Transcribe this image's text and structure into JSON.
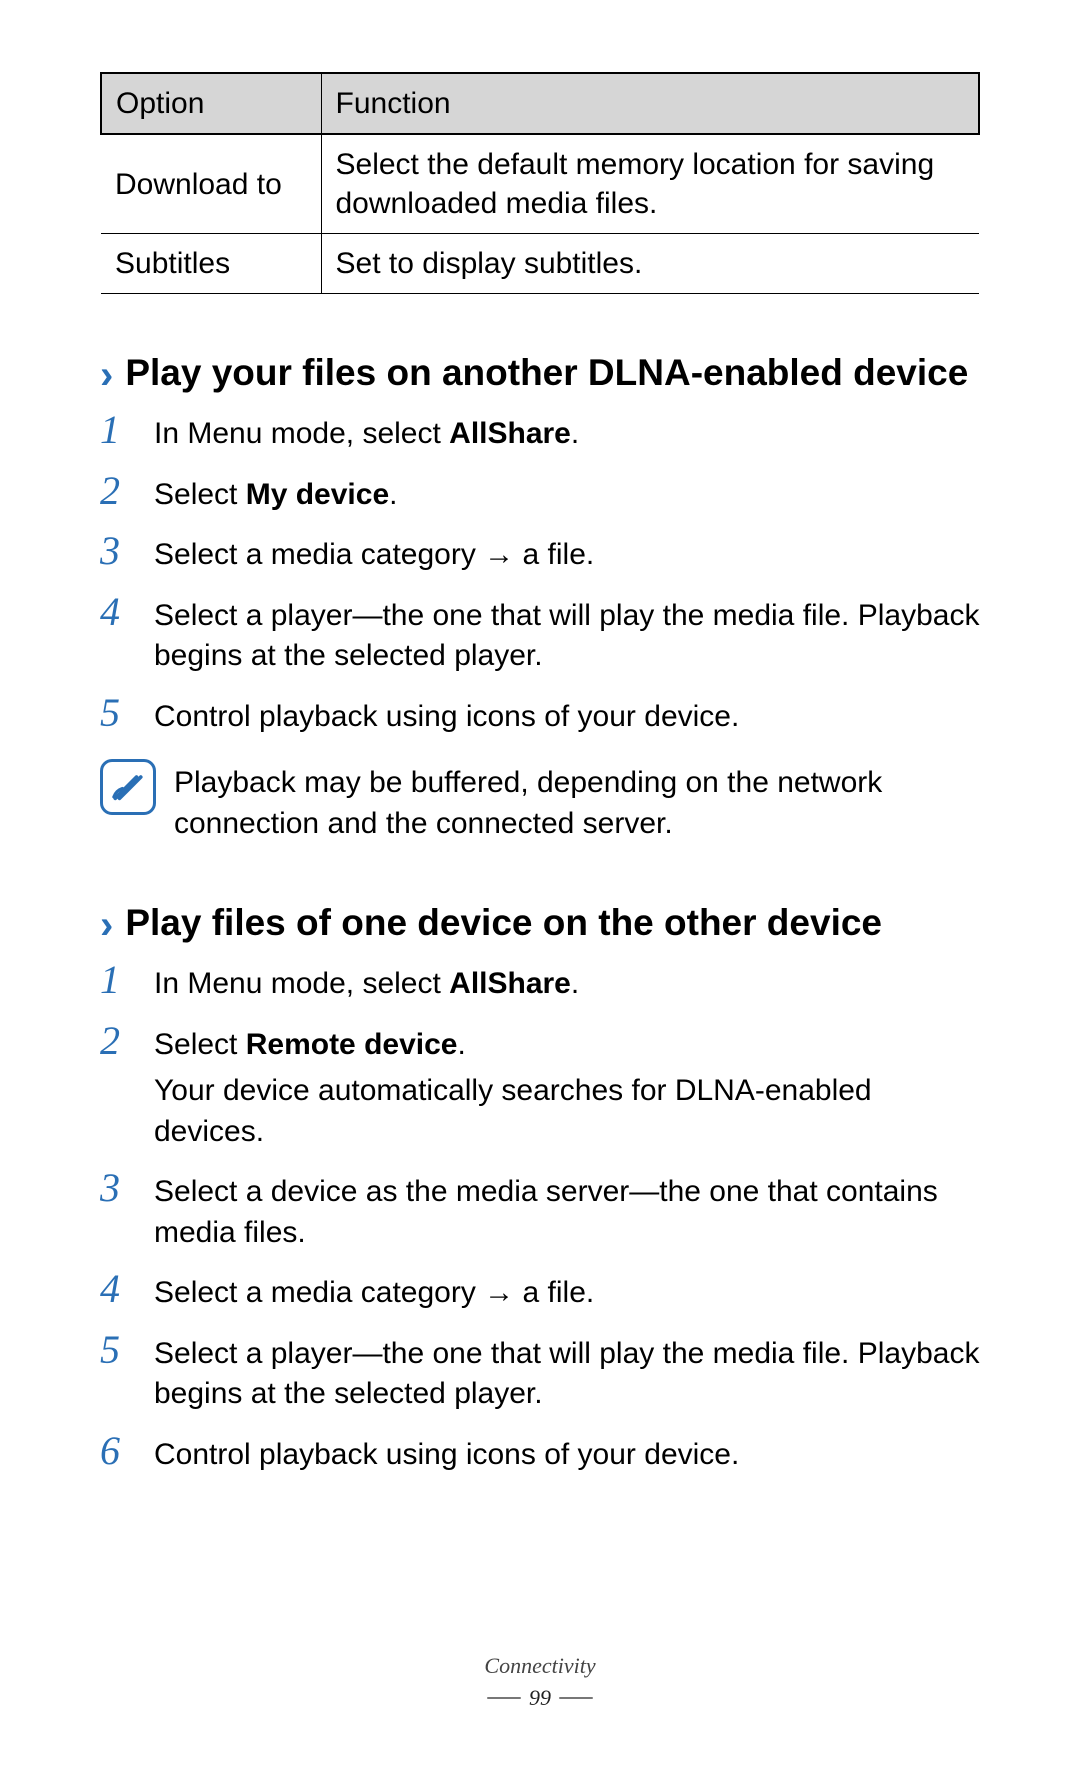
{
  "table": {
    "headers": {
      "option": "Option",
      "function": "Function"
    },
    "rows": [
      {
        "option": "Download to",
        "function": "Select the default memory location for saving downloaded media files."
      },
      {
        "option": "Subtitles",
        "function": "Set to display subtitles."
      }
    ]
  },
  "section1": {
    "title": "Play your files on another DLNA-enabled device",
    "steps": {
      "s1": {
        "n": "1",
        "pre": "In Menu mode, select ",
        "bold": "AllShare",
        "post": "."
      },
      "s2": {
        "n": "2",
        "pre": "Select ",
        "bold": "My device",
        "post": "."
      },
      "s3": {
        "n": "3",
        "text": "Select a media category → a file."
      },
      "s4": {
        "n": "4",
        "text": "Select a player—the one that will play the media file. Playback begins at the selected player."
      },
      "s5": {
        "n": "5",
        "text": "Control playback using icons of your device."
      }
    },
    "note": "Playback may be buffered, depending on the network connection and the connected server."
  },
  "section2": {
    "title": "Play files of one device on the other device",
    "steps": {
      "s1": {
        "n": "1",
        "pre": "In Menu mode, select ",
        "bold": "AllShare",
        "post": "."
      },
      "s2": {
        "n": "2",
        "pre": "Select ",
        "bold": "Remote device",
        "post": ".",
        "sub": "Your device automatically searches for DLNA-enabled devices."
      },
      "s3": {
        "n": "3",
        "text": "Select a device as the media server—the one that contains media files."
      },
      "s4": {
        "n": "4",
        "text": "Select a media category → a file."
      },
      "s5": {
        "n": "5",
        "text": "Select a player—the one that will play the media file. Playback begins at the selected player."
      },
      "s6": {
        "n": "6",
        "text": "Control playback using icons of your device."
      }
    }
  },
  "footer": {
    "chapter": "Connectivity",
    "page": "99"
  }
}
